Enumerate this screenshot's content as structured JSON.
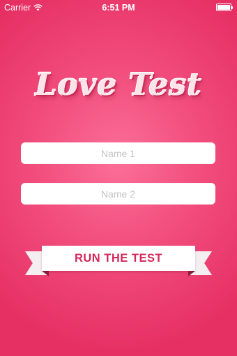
{
  "status_bar": {
    "carrier": "Carrier",
    "time": "6:51 PM"
  },
  "title": "Love Test",
  "inputs": {
    "name1_placeholder": "Name 1",
    "name2_placeholder": "Name 2",
    "name1_value": "",
    "name2_value": ""
  },
  "button": {
    "label": "RUN THE TEST"
  },
  "colors": {
    "background": "#f24e7e",
    "button_text": "#d3285a"
  },
  "icons": {
    "wifi": "wifi-icon",
    "battery": "battery-icon"
  }
}
